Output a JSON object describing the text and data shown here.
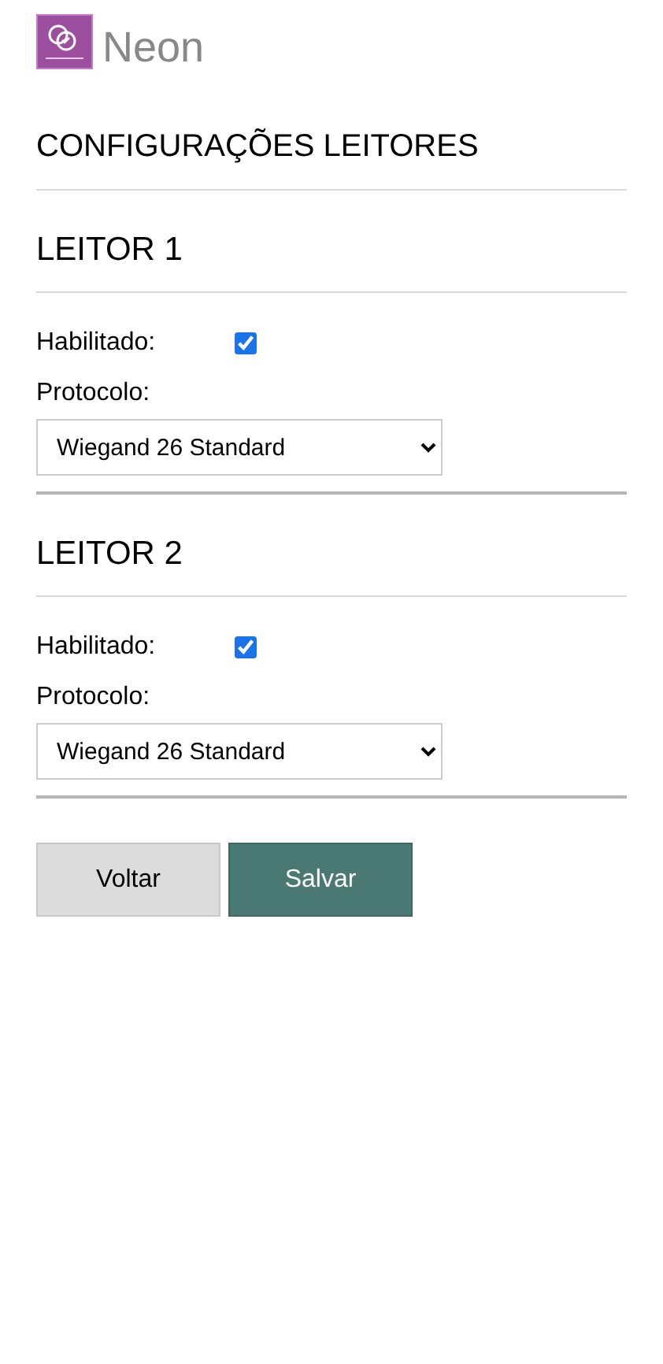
{
  "brand": {
    "name": "Neon"
  },
  "title": "CONFIGURAÇÕES LEITORES",
  "readers": [
    {
      "heading": "LEITOR 1",
      "enabled_label": "Habilitado:",
      "enabled": {
        "checked": true
      },
      "protocol_label": "Protocolo:",
      "protocol": "Wiegand 26 Standard"
    },
    {
      "heading": "LEITOR 2",
      "enabled_label": "Habilitado:",
      "enabled": {
        "checked": true
      },
      "protocol_label": "Protocolo:",
      "protocol": "Wiegand 26 Standard"
    }
  ],
  "buttons": [
    {
      "label": "Voltar",
      "kind": "secondary"
    },
    {
      "label": "Salvar",
      "kind": "primary"
    }
  ]
}
